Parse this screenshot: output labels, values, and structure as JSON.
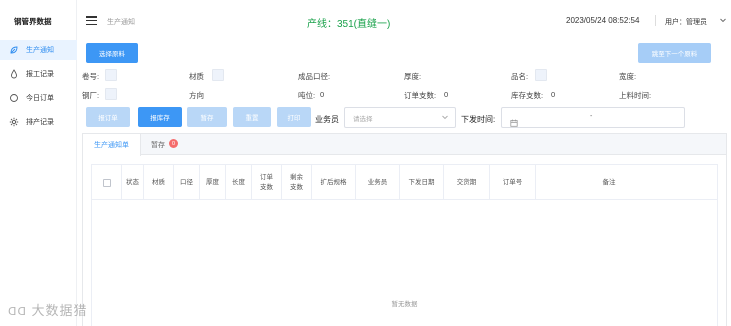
{
  "sidebar": {
    "brand": "钢管界数据",
    "items": [
      {
        "label": "生产通知",
        "icon": "leaf-icon",
        "active": true
      },
      {
        "label": "报工记录",
        "icon": "drop-icon",
        "active": false
      },
      {
        "label": "今日订单",
        "icon": "circle-icon",
        "active": false
      },
      {
        "label": "排产记录",
        "icon": "gear-icon",
        "active": false
      }
    ]
  },
  "header": {
    "breadcrumb": "生产通知",
    "line_title": "产线：351(直缝一)",
    "datetime": "2023/05/24 08:52:54",
    "user_label": "用户：",
    "user_name": "管理员"
  },
  "toolbar_top": {
    "select_material": "选择原料",
    "next_material": "跳至下一个原料"
  },
  "fields": {
    "coil_no": "卷号:",
    "material": "材质",
    "finished_diameter": "成品口径:",
    "thickness": "厚度:",
    "product_name": "品名:",
    "width": "宽度:",
    "steel_mill": "钢厂:",
    "direction": "方向",
    "ton_label": "吨位:",
    "ton_value": "0",
    "order_count_label": "订单支数:",
    "order_count_value": "0",
    "stock_count_label": "库存支数:",
    "stock_count_value": "0",
    "feed_time": "上料时间:"
  },
  "actions": {
    "report_order": "报订单",
    "report_stock": "报库存",
    "save_draft": "暂存",
    "reset": "重置",
    "print": "打印"
  },
  "filters": {
    "salesperson_label": "业务员",
    "salesperson_placeholder": "请选择",
    "issue_time_label": "下发时间:",
    "range_separator": "-"
  },
  "tabs": [
    {
      "label": "生产通知单",
      "active": true
    },
    {
      "label": "暂存",
      "badge": "0"
    }
  ],
  "table": {
    "columns": [
      "状态",
      "材质",
      "口径",
      "厚度",
      "长度",
      "订单\n支数",
      "剩余\n支数",
      "扩后规格",
      "业务员",
      "下发日期",
      "交货期",
      "订单号",
      "备注"
    ],
    "empty_text": "暂无数据"
  },
  "watermark": "大数据猎"
}
